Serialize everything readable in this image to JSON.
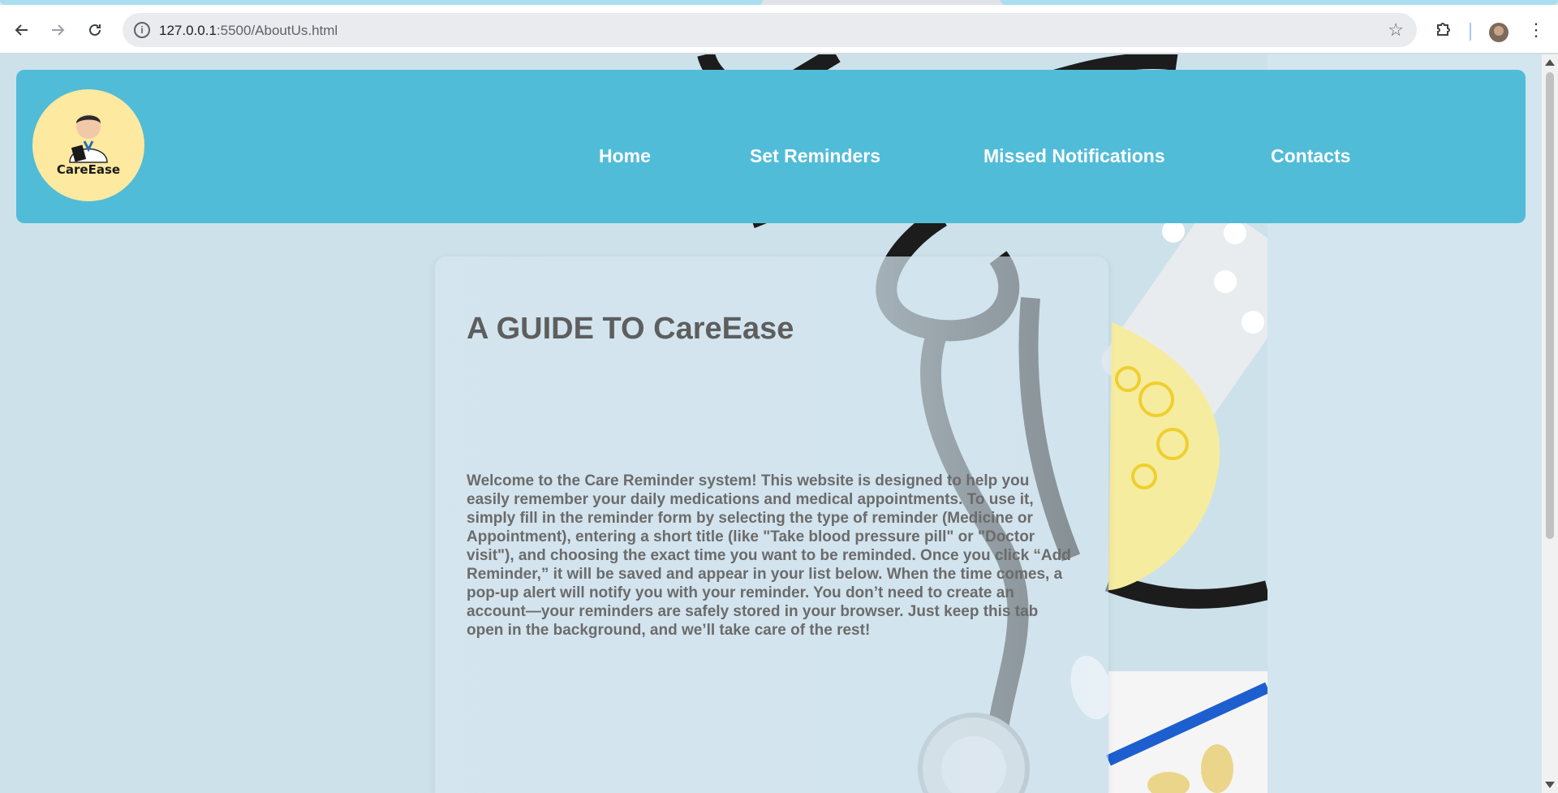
{
  "browser": {
    "url_host": "127.0.0.1",
    "url_rest": ":5500/AboutUs.html",
    "icons": [
      "back-arrow-icon",
      "forward-arrow-icon",
      "reload-icon",
      "site-info-icon",
      "bookmark-star-icon",
      "extensions-icon",
      "profile-avatar",
      "more-menu-icon"
    ]
  },
  "header": {
    "logo_text": "CareEase",
    "nav": [
      {
        "label": "Home"
      },
      {
        "label": "Set Reminders"
      },
      {
        "label": "Missed Notifications"
      },
      {
        "label": "Contacts"
      }
    ]
  },
  "card": {
    "title": "A GUIDE TO CareEase",
    "body": "Welcome to the Care Reminder system! This website is designed to help you easily remember your daily medications and medical appointments. To use it, simply fill in the reminder form by selecting the type of reminder (Medicine or Appointment), entering a short title (like \"Take blood pressure pill\" or \"Doctor visit\"), and choosing the exact time you want to be reminded. Once you click “Add Reminder,” it will be saved and appear in your list below. When the time comes, a pop-up alert will notify you with your reminder. You don’t need to create an account—your reminders are safely stored in your browser. Just keep this tab open in the background, and we’ll take care of the rest!"
  },
  "colors": {
    "header_bg": "#51bcd8",
    "page_bg": "#d3e5ee",
    "logo_bg": "#fde9a0",
    "text_dark": "#5e5e5e"
  }
}
